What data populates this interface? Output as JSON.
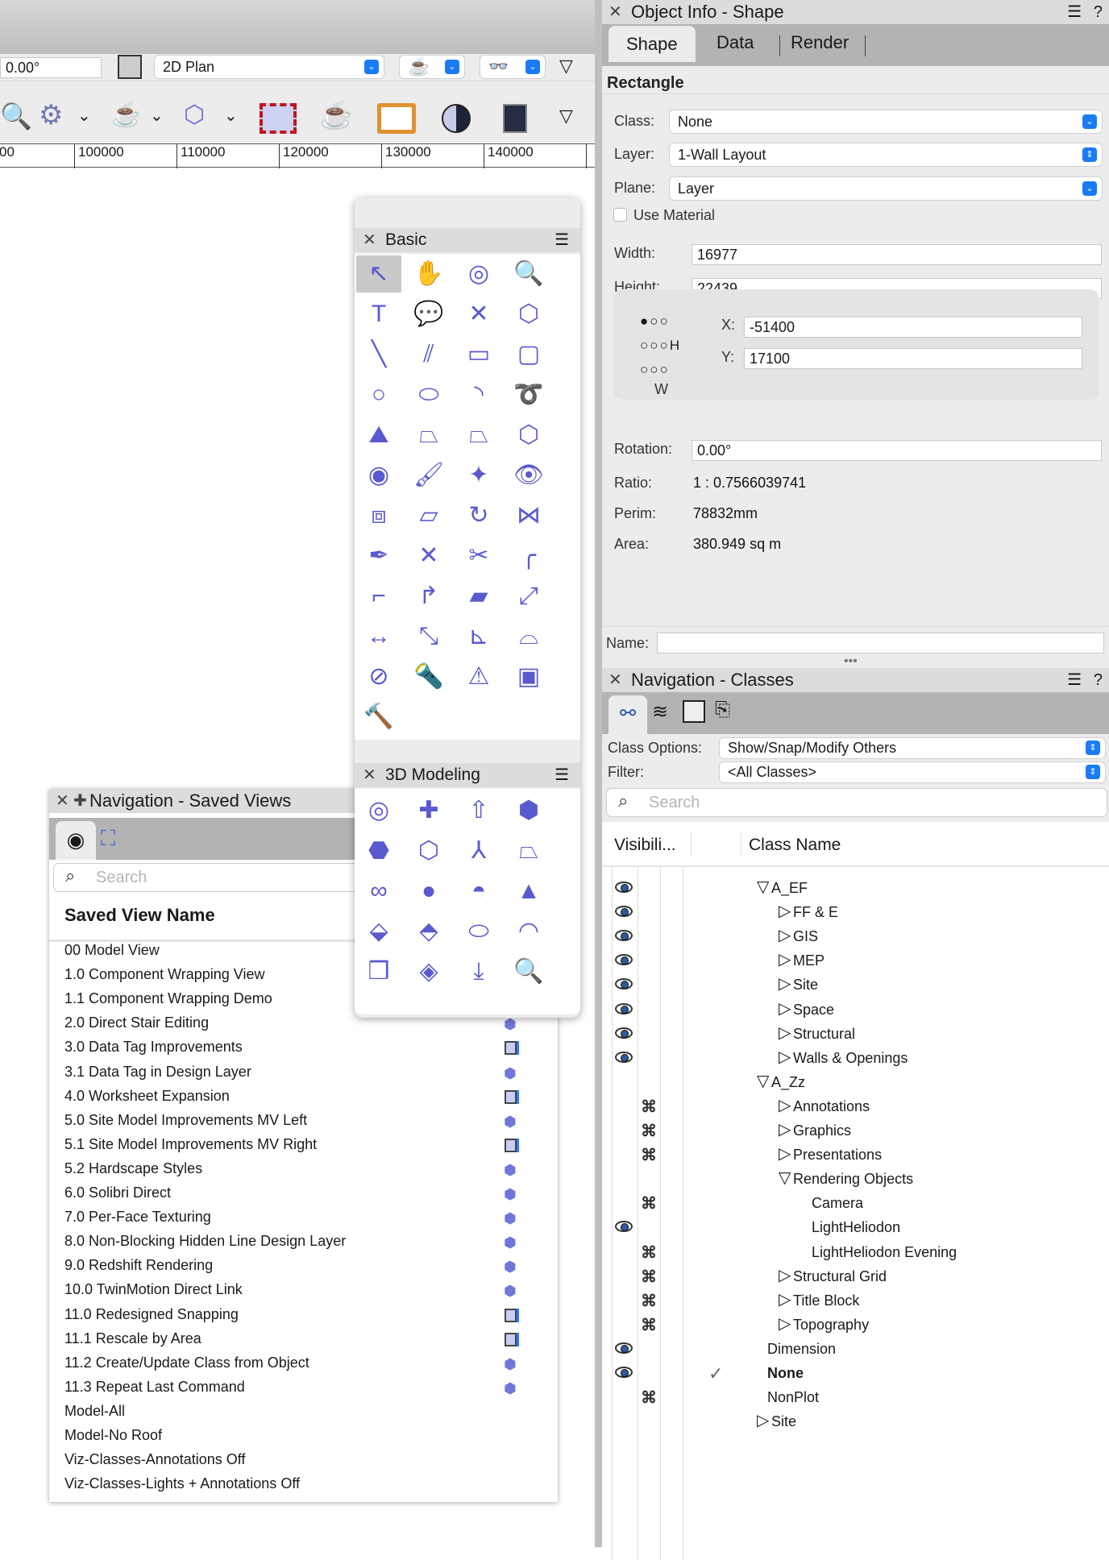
{
  "toolbar": {
    "rotation_value": "0.00°",
    "view_select": "2D Plan",
    "render_icon": "teapot-icon",
    "stereo_icon": "3d-glasses-icon",
    "row2_icons": [
      "magnifier-icon",
      "gear-icon",
      "teapot-link-icon",
      "shape-link-icon",
      "red-hatched-rect-icon",
      "teapot-icon",
      "frame-eye-icon",
      "half-circle-icon",
      "door-icon"
    ]
  },
  "ruler": {
    "labels": [
      "00",
      "100000",
      "110000",
      "120000",
      "130000",
      "140000"
    ]
  },
  "object_info": {
    "title": "Object Info - Shape",
    "tabs": [
      "Shape",
      "Data",
      "Render"
    ],
    "active_tab": "Shape",
    "object_type": "Rectangle",
    "class_label": "Class:",
    "class_value": "None",
    "layer_label": "Layer:",
    "layer_value": "1-Wall Layout",
    "plane_label": "Plane:",
    "plane_value": "Layer",
    "use_material": "Use Material",
    "width_label": "Width:",
    "width_value": "16977",
    "height_label": "Height:",
    "height_value": "22439",
    "h_label": "H",
    "w_label": "W",
    "x_label": "X:",
    "x_value": "-51400",
    "y_label": "Y:",
    "y_value": "17100",
    "rotation_label": "Rotation:",
    "rotation_value": "0.00°",
    "ratio_label": "Ratio:",
    "ratio_value": "1 : 0.7566039741",
    "perim_label": "Perim:",
    "perim_value": "78832mm",
    "area_label": "Area:",
    "area_value": "380.949 sq m",
    "name_label": "Name:",
    "name_value": ""
  },
  "nav_classes": {
    "title": "Navigation - Classes",
    "class_options_label": "Class Options:",
    "class_options_value": "Show/Snap/Modify Others",
    "filter_label": "Filter:",
    "filter_value": "<All Classes>",
    "search_placeholder": "Search",
    "col_visibility": "Visibili...",
    "col_name": "Class Name",
    "rows": [
      {
        "name": "A_EF",
        "level": 0,
        "expander": "open",
        "vis": "visible"
      },
      {
        "name": "FF & E",
        "level": 1,
        "expander": "closed",
        "vis": "visible"
      },
      {
        "name": "GIS",
        "level": 1,
        "expander": "closed",
        "vis": "visible"
      },
      {
        "name": "MEP",
        "level": 1,
        "expander": "closed",
        "vis": "visible"
      },
      {
        "name": "Site",
        "level": 1,
        "expander": "closed",
        "vis": "visible"
      },
      {
        "name": "Space",
        "level": 1,
        "expander": "closed",
        "vis": "visible"
      },
      {
        "name": "Structural",
        "level": 1,
        "expander": "closed",
        "vis": "visible"
      },
      {
        "name": "Walls & Openings",
        "level": 1,
        "expander": "closed",
        "vis": "visible"
      },
      {
        "name": "A_Zz",
        "level": 0,
        "expander": "open",
        "vis": ""
      },
      {
        "name": "Annotations",
        "level": 1,
        "expander": "closed",
        "vis": "invisible"
      },
      {
        "name": "Graphics",
        "level": 1,
        "expander": "closed",
        "vis": "invisible"
      },
      {
        "name": "Presentations",
        "level": 1,
        "expander": "closed",
        "vis": "invisible"
      },
      {
        "name": "Rendering Objects",
        "level": 1,
        "expander": "open",
        "vis": ""
      },
      {
        "name": "Camera",
        "level": 2,
        "expander": "none",
        "vis": "invisible"
      },
      {
        "name": "LightHeliodon",
        "level": 2,
        "expander": "none",
        "vis": "visible"
      },
      {
        "name": "LightHeliodon Evening",
        "level": 2,
        "expander": "none",
        "vis": "invisible"
      },
      {
        "name": "Structural Grid",
        "level": 1,
        "expander": "closed",
        "vis": "invisible"
      },
      {
        "name": "Title Block",
        "level": 1,
        "expander": "closed",
        "vis": "invisible"
      },
      {
        "name": "Topography",
        "level": 1,
        "expander": "closed",
        "vis": "invisible"
      },
      {
        "name": "Dimension",
        "level": 0,
        "expander": "none",
        "vis": "visible"
      },
      {
        "name": "None",
        "level": 0,
        "expander": "none",
        "vis": "visible",
        "active": true
      },
      {
        "name": "NonPlot",
        "level": 0,
        "expander": "none",
        "vis": "invisible"
      },
      {
        "name": "Site",
        "level": 0,
        "expander": "closed",
        "vis": ""
      }
    ]
  },
  "basic_palette": {
    "title": "Basic",
    "tools": [
      "↖",
      "✋",
      "◎",
      "🔍",
      "T",
      "💬",
      "✕",
      "⬡",
      "╲",
      "⫽",
      "▭",
      "▢",
      "○",
      "⬭",
      "◝",
      "➰",
      "⛰",
      "⏢",
      "⏢",
      "⬡",
      "◉",
      "🖌",
      "✦",
      "👁",
      "⧈",
      "▱",
      "↻",
      "⋈",
      "✒",
      "✕",
      "✂",
      "╭",
      "⌐",
      "↱",
      "▰",
      "⤢",
      "↔",
      "⤡",
      "⊾",
      "⌓",
      "⊘",
      "🔦",
      "⚠",
      "▣",
      "🔨"
    ]
  },
  "modeling_palette": {
    "title": "3D Modeling",
    "tools": [
      "◎",
      "✚",
      "⇧",
      "⬢",
      "⬣",
      "⬡",
      "⅄",
      "⏢",
      "∞",
      "●",
      "◓",
      "▲",
      "⬙",
      "⬘",
      "⬭",
      "◠",
      "❒",
      "◈",
      "⤓",
      "🔍"
    ]
  },
  "saved_views": {
    "title": "Navigation - Saved Views",
    "search_placeholder": "Search",
    "col_name": "Saved View Name",
    "rows": [
      {
        "name": "00 Model View",
        "type": ""
      },
      {
        "name": "1.0 Component Wrapping View",
        "type": ""
      },
      {
        "name": "1.1 Component Wrapping Demo",
        "type": ""
      },
      {
        "name": "2.0 Direct Stair Editing",
        "type": "cube"
      },
      {
        "name": "3.0 Data Tag Improvements",
        "type": "sheet"
      },
      {
        "name": "3.1 Data Tag in Design Layer",
        "type": "cube"
      },
      {
        "name": "4.0 Worksheet Expansion",
        "type": "sheet"
      },
      {
        "name": "5.0 Site Model Improvements MV Left",
        "type": "cube"
      },
      {
        "name": "5.1 Site Model Improvements MV Right",
        "type": "sheet"
      },
      {
        "name": "5.2 Hardscape Styles",
        "type": "cube"
      },
      {
        "name": "6.0 Solibri Direct",
        "type": "cube"
      },
      {
        "name": "7.0 Per-Face Texturing",
        "type": "cube"
      },
      {
        "name": "8.0 Non-Blocking Hidden Line Design Layer",
        "type": "cube"
      },
      {
        "name": "9.0 Redshift Rendering",
        "type": "cube"
      },
      {
        "name": "10.0 TwinMotion Direct Link",
        "type": "cube"
      },
      {
        "name": "11.0 Redesigned Snapping",
        "type": "sheet"
      },
      {
        "name": "11.1 Rescale by Area",
        "type": "sheet"
      },
      {
        "name": "11.2 Create/Update Class from Object",
        "type": "cube"
      },
      {
        "name": "11.3 Repeat Last Command",
        "type": "cube"
      },
      {
        "name": "Model-All",
        "type": ""
      },
      {
        "name": "Model-No Roof",
        "type": ""
      },
      {
        "name": "Viz-Classes-Annotations Off",
        "type": ""
      },
      {
        "name": "Viz-Classes-Lights + Annotations Off",
        "type": ""
      }
    ]
  },
  "colors": {
    "accent": "#1a7cf5",
    "panel": "#ececec",
    "tab_bar": "#b3b3b3",
    "icon_fill": "#c5c8f5"
  }
}
